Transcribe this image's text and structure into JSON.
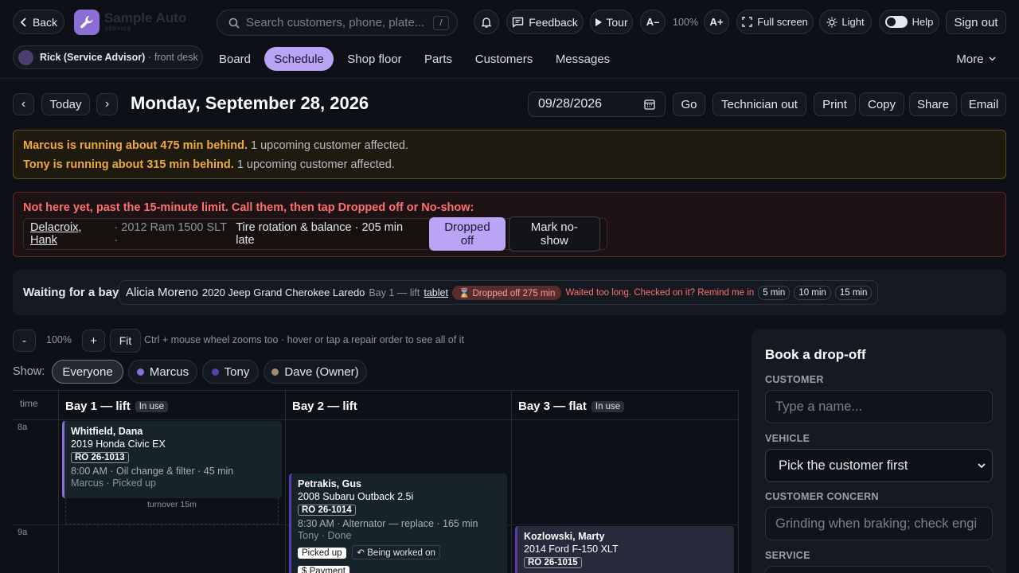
{
  "header": {
    "back_label": "Back",
    "brand_name": "Sample Auto",
    "brand_sub": "SERVICE",
    "search_placeholder": "Search customers, phone, plate...",
    "search_shortcut": "/",
    "feedback_label": "Feedback",
    "tour_label": "Tour",
    "font_smaller": "A–",
    "zoom_level": "100%",
    "font_larger": "A+",
    "fullscreen_label": "Full screen",
    "theme_label": "Light",
    "help_label": "Help",
    "signout_label": "Sign out"
  },
  "user": {
    "name": "Rick (Service Advisor)",
    "role": "· front desk"
  },
  "nav": {
    "items": [
      "Board",
      "Schedule",
      "Shop floor",
      "Parts",
      "Customers",
      "Messages"
    ],
    "more_label": "More"
  },
  "date_bar": {
    "prev_label": "‹",
    "today_label": "Today",
    "next_label": "›",
    "title": "Monday, September 28, 2026",
    "date_value": "09/28/2026",
    "go_label": "Go",
    "technician_out_label": "Technician out",
    "print_label": "Print",
    "copy_label": "Copy",
    "share_label": "Share",
    "email_label": "Email"
  },
  "late_banner": {
    "lines": [
      {
        "bold": "Marcus is running about 475 min behind.",
        "rest": "1 upcoming customer affected."
      },
      {
        "bold": "Tony is running about 315 min behind.",
        "rest": "1 upcoming customer affected."
      }
    ]
  },
  "noshow_banner": {
    "title": "Not here yet, past the 15-minute limit. Call them, then tap Dropped off or No-show:",
    "customer": "Delacroix, Hank",
    "details_muted": "· 2012 Ram 1500 SLT ·",
    "details": "Tire rotation & balance · 205 min late",
    "dropped_label": "Dropped off",
    "noshow_label": "Mark no-show"
  },
  "waiting": {
    "title": "Waiting for a bay",
    "customer": "Alicia Moreno",
    "vehicle": "2020 Jeep Grand Cherokee Laredo",
    "bay": "Bay 1 — lift",
    "tablet_label": "tablet",
    "dropped_tag": "Dropped off 275 min",
    "warning": "Waited too long. Checked on it? Remind me in",
    "remind_options": [
      "5 min",
      "10 min",
      "15 min"
    ]
  },
  "zoom": {
    "minus_label": "-",
    "level": "100%",
    "plus_label": "+",
    "fit_label": "Fit",
    "hint": "Ctrl + mouse wheel zooms too · hover or tap a repair order to see all of it"
  },
  "filters": {
    "show_label": "Show:",
    "options": [
      {
        "label": "Everyone",
        "color": ""
      },
      {
        "label": "Marcus",
        "color": "#8b6fd6"
      },
      {
        "label": "Tony",
        "color": "#5b3fb0"
      },
      {
        "label": "Dave (Owner)",
        "color": "#a08a6a"
      }
    ]
  },
  "schedule": {
    "time_header": "time",
    "hours": [
      "8a",
      "9a"
    ],
    "bays": [
      {
        "name": "Bay 1 — lift",
        "status": "In use"
      },
      {
        "name": "Bay 2 — lift",
        "status": ""
      },
      {
        "name": "Bay 3 — flat",
        "status": "In use"
      }
    ],
    "turnover_label": "turnover 15m",
    "orders": [
      {
        "customer": "Whitfield, Dana",
        "vehicle": "2019 Honda Civic EX",
        "ro": "RO 26-1013",
        "line": "8:00 AM · Oil change & filter · 45 min",
        "tech_status": "Marcus · Picked up"
      },
      {
        "customer": "Petrakis, Gus",
        "vehicle": "2008 Subaru Outback 2.5i",
        "ro": "RO 26-1014",
        "line": "8:30 AM · Alternator — replace · 165 min",
        "tech_status": "Tony · Done",
        "badge": "Picked up",
        "badge2": "Being worked on",
        "badge3": "$ Payment"
      },
      {
        "customer": "Kozlowski, Marty",
        "vehicle": "2014 Ford F-150 XLT",
        "ro": "RO 26-1015"
      }
    ]
  },
  "booking": {
    "title": "Book a drop-off",
    "customer_label": "CUSTOMER",
    "customer_placeholder": "Type a name...",
    "vehicle_label": "VEHICLE",
    "vehicle_value": "Pick the customer first",
    "concern_label": "CUSTOMER CONCERN",
    "concern_placeholder": "Grinding when braking; check engi",
    "service_label": "SERVICE"
  },
  "colors": {
    "accent": "#b9a4f5",
    "warning": "#f0a93a",
    "danger": "#ff6f6f"
  }
}
